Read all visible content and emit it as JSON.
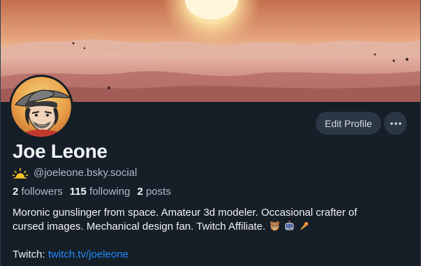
{
  "profile": {
    "display_name": "Joe Leone",
    "handle": "@joeleone.bsky.social",
    "followers_count": "2",
    "followers_label": "followers",
    "following_count": "115",
    "following_label": "following",
    "posts_count": "2",
    "posts_label": "posts",
    "bio_line1": "Moronic gunslinger from space. Amateur 3d modeler. Occasional crafter of",
    "bio_line2": "cursed images. Mechanical design fan. Twitch Affiliate.",
    "twitch_label": "Twitch:",
    "twitch_link": "twitch.tv/joeleone"
  },
  "actions": {
    "edit_profile_label": "Edit Profile"
  },
  "icons": {
    "handle_badge": "sun-icon",
    "more": "ellipsis-icon",
    "bio_emojis": [
      "bear-face-emoji",
      "robot-emoji",
      "comet-emoji"
    ]
  },
  "colors": {
    "background": "#161e27",
    "button_bg": "#2b3744",
    "link": "#208bfe",
    "muted_text": "#aebbc9",
    "primary_text": "#f1f3f5"
  }
}
